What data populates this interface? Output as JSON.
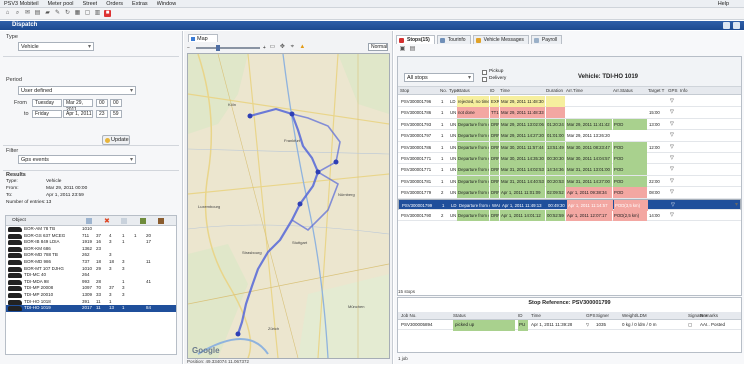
{
  "menu": {
    "items": [
      "PSV3 Mobiteil",
      "Meter pool",
      "Street",
      "Orders",
      "Extras",
      "Window"
    ],
    "help": "Help"
  },
  "window": {
    "title": "Dispatch"
  },
  "left": {
    "type_label": "Type",
    "type_value": "Vehicle",
    "period_label": "Period",
    "period_value": "User defined",
    "from_label": "From",
    "from_day": "Tuesday",
    "from_date": "Mar 29, 2011",
    "from_h": "00",
    "from_m": "00",
    "to_label": "to",
    "to_day": "Friday",
    "to_date": "Apr 1, 2011",
    "to_h": "23",
    "to_m": "59",
    "update_label": "Update",
    "filter_label": "Filter",
    "filter_value": "Gps events",
    "results_label": "Results",
    "summary": [
      {
        "k": "Type:",
        "v": "Vehicle"
      },
      {
        "k": "From:",
        "v": "Mar 29, 2011  00:00"
      },
      {
        "k": "To:",
        "v": "Apr 1, 2011  23:59"
      },
      {
        "k": "Number of entries:",
        "v": "13"
      }
    ],
    "res_header": "Object",
    "vehicles": [
      {
        "name": "BOR-AM 78 TB",
        "c1": "1010",
        "c2": "",
        "c3": "",
        "c4": "",
        "c5": "",
        "c6": ""
      },
      {
        "name": "BOR-GS 637 MCEG",
        "c1": "711",
        "c2": "37",
        "c3": "4",
        "c4": "1",
        "c5": "1",
        "c6": "20"
      },
      {
        "name": "BOR-IB 849 LDIA",
        "c1": "1919",
        "c2": "16",
        "c3": "3",
        "c4": "1",
        "c5": "",
        "c6": "17"
      },
      {
        "name": "BOR-KM 686",
        "c1": "1362",
        "c2": "23",
        "c3": "",
        "c4": "",
        "c5": "",
        "c6": ""
      },
      {
        "name": "BOR-MD 788 TB",
        "c1": "262",
        "c2": "",
        "c3": "3",
        "c4": "",
        "c5": "",
        "c6": ""
      },
      {
        "name": "BOR-MD 986",
        "c1": "737",
        "c2": "18",
        "c3": "18",
        "c4": "3",
        "c5": "",
        "c6": "11"
      },
      {
        "name": "BOR-MT 107 DJHG",
        "c1": "1010",
        "c2": "29",
        "c3": "3",
        "c4": "3",
        "c5": "",
        "c6": ""
      },
      {
        "name": "TDI-MC 40",
        "c1": "264",
        "c2": "",
        "c3": "",
        "c4": "",
        "c5": "",
        "c6": ""
      },
      {
        "name": "TDI-MDA 98",
        "c1": "993",
        "c2": "28",
        "c3": "",
        "c4": "1",
        "c5": "",
        "c6": "41"
      },
      {
        "name": "TDI-MP 20008",
        "c1": "1097",
        "c2": "70",
        "c3": "37",
        "c4": "3",
        "c5": "",
        "c6": ""
      },
      {
        "name": "TDI-MP 20010",
        "c1": "1309",
        "c2": "33",
        "c3": "3",
        "c4": "3",
        "c5": "",
        "c6": ""
      },
      {
        "name": "TDI-HO 1018",
        "c1": "391",
        "c2": "11",
        "c3": "1",
        "c4": "",
        "c5": "",
        "c6": ""
      },
      {
        "name": "TDI-HO 1019",
        "c1": "2017",
        "c2": "11",
        "c3": "13",
        "c4": "1",
        "c5": "",
        "c6": "84"
      }
    ]
  },
  "map": {
    "tab": "Map",
    "mode": "Normal",
    "status": "Position: 49.334074 11.067372",
    "logo": "Google",
    "towns": [
      "Frankfurt",
      "Nürnberg",
      "Stuttgart",
      "München",
      "Köln",
      "Luxembourg",
      "Strasbourg",
      "Zürich"
    ]
  },
  "right": {
    "tabs": [
      {
        "label": "Stops(15)",
        "color": "#d32f2f"
      },
      {
        "label": "Tourinfo",
        "color": "#6f8fb8"
      },
      {
        "label": "Vehicle Messages",
        "color": "#e0a229"
      },
      {
        "label": "Payroll",
        "color": "#9ab0c8"
      }
    ],
    "filter_value": "All stops",
    "check_pickup": "Pickup",
    "check_delivery": "Delivery",
    "vehicle_title": "Vehicle: TDI-HO 1019",
    "columns": [
      "Stop",
      "No.",
      "Type",
      "Status",
      "ID",
      "Time",
      "Duration",
      "Arr.Time",
      "Arr.Status",
      "Target T",
      "GPS",
      "Info"
    ],
    "stops": [
      {
        "stop": "PSV300001796",
        "no": "1",
        "type": "LD",
        "status": "rejected, no time",
        "id": "EXR",
        "time": "Mar 29, 2011 11:48:30",
        "dur": "",
        "arr": "",
        "ast": "",
        "tgt": "",
        "sc": "y",
        "ac": ""
      },
      {
        "stop": "PSV300001786",
        "no": "1",
        "type": "UN",
        "status": "not done",
        "id": "TT1",
        "time": "Mar 29, 2011 11:48:33",
        "dur": "",
        "arr": "",
        "ast": "",
        "tgt": "15:00",
        "sc": "r",
        "ac": ""
      },
      {
        "stop": "PSV300001793",
        "no": "1",
        "type": "UN",
        "status": "Departure from cus",
        "id": "DRP",
        "time": "Mar 29, 2011 13:02:06",
        "dur": "01:20:24",
        "arr": "Mar 29, 2011 11:41:42",
        "ast": "POD",
        "tgt": "13:00",
        "sc": "g",
        "ac": "g"
      },
      {
        "stop": "PSV300001797",
        "no": "1",
        "type": "UN",
        "status": "Departure from cus",
        "id": "DRP",
        "time": "Mar 29, 2011 14:27:20",
        "dur": "01:01:00",
        "arr": "Mar 29, 2011 13:26:20",
        "ast": "",
        "tgt": "",
        "sc": "g",
        "ac": ""
      },
      {
        "stop": "PSV300001786",
        "no": "1",
        "type": "UN",
        "status": "Departure from cus",
        "id": "DRP",
        "time": "Mar 30, 2011 11:57:44",
        "dur": "13:51:49",
        "arr": "Mar 30, 2011 08:23:47",
        "ast": "POD",
        "tgt": "12:00",
        "sc": "g",
        "ac": "g"
      },
      {
        "stop": "PSV300001771",
        "no": "1",
        "type": "UN",
        "status": "Departure from cus",
        "id": "DRP",
        "time": "Mar 30, 2011 14:35:30",
        "dur": "00:30:30",
        "arr": "Mar 30, 2011 14:04:57",
        "ast": "POD",
        "tgt": "",
        "sc": "g",
        "ac": "g"
      },
      {
        "stop": "PSV300001771",
        "no": "1",
        "type": "UN",
        "status": "Departure from cus",
        "id": "DRP",
        "time": "Mar 31, 2011 14:02:53",
        "dur": "14:34:36",
        "arr": "Mar 31, 2011 13:01:00",
        "ast": "POD",
        "tgt": "",
        "sc": "g",
        "ac": "g"
      },
      {
        "stop": "PSV300001781",
        "no": "1",
        "type": "UN",
        "status": "Departure from cus",
        "id": "DRP",
        "time": "Mar 31, 2011 14:40:53",
        "dur": "00:20:53",
        "arr": "Mar 31, 2011 14:27:00",
        "ast": "POD",
        "tgt": "22:00",
        "sc": "g",
        "ac": "g"
      },
      {
        "stop": "PSV300001779",
        "no": "2",
        "type": "UN",
        "status": "Departure from cus",
        "id": "DRP",
        "time": "Apr 1, 2011 11:01:09",
        "dur": "02:09:52",
        "arr": "Apr 1, 2011 09:38:34",
        "ast": "POD",
        "tgt": "08:00",
        "sc": "g",
        "ac": "r"
      },
      {
        "stop": "PSV300001799",
        "no": "1",
        "type": "LD",
        "status": "Departure from cus",
        "id": "WAI",
        "time": "Apr 1, 2011 11:49:13",
        "dur": "00:49:30",
        "arr": "Apr 1, 2011 11:14:57",
        "ast": "POD(3,5 km)",
        "tgt": "",
        "sc": "sel",
        "ac": "r"
      },
      {
        "stop": "PSV300001790",
        "no": "2",
        "type": "UN",
        "status": "Departure from cus",
        "id": "DRP",
        "time": "Apr 1, 2011 14:01:12",
        "dur": "00:52:59",
        "arr": "Apr 1, 2011 12:07:17",
        "ast": "POD(2,5 km)",
        "tgt": "14:00",
        "sc": "g",
        "ac": "r"
      }
    ],
    "stop_count": "15 stops",
    "ref_title": "Stop Reference: PSV300001799",
    "ref_columns": [
      "Job No.",
      "Status",
      "ID",
      "Time",
      "GPS",
      "Signer",
      "Weight/LDM",
      "Signature",
      "Remarks"
    ],
    "ref_row": {
      "job": "PSV300005894",
      "status": "picked up",
      "id": "PU",
      "time": "Apr 1, 2011 11:39:28",
      "signer": "1035",
      "weight": "0 kg / 0 ldm / 0 m",
      "remarks": "AAI.. Posted"
    },
    "bottom_status": "1 job"
  },
  "colors": {
    "accent": "#1f4f9b",
    "done": "#a9d18e",
    "fail": "#f3a7a2",
    "warn": "#f6ef9e",
    "route": "#5566d8"
  }
}
